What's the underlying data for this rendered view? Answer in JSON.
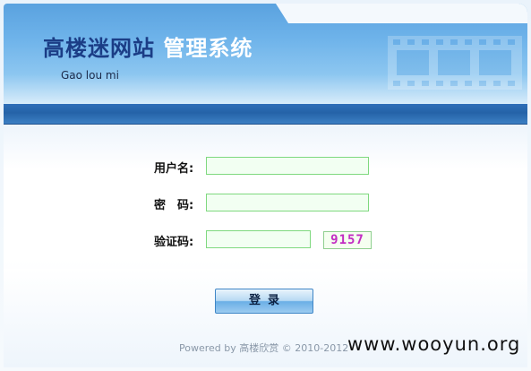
{
  "header": {
    "brand": "高楼迷网站",
    "system": "管理系统",
    "subtitle": "Gao lou mi"
  },
  "form": {
    "username_label": "用户名:",
    "username_value": "",
    "password_label": "密　码:",
    "password_value": "",
    "captcha_label": "验证码:",
    "captcha_value": "",
    "captcha_code": "9157",
    "login_label": "登录"
  },
  "footer": {
    "copyright": "Powered by 高楼欣赏 © 2010-2012"
  },
  "watermark": "www.wooyun.org",
  "colors": {
    "header_top": "#5aa2df",
    "band": "#2563a8",
    "field_border": "#7fd97f",
    "captcha_text": "#c22cc2"
  }
}
